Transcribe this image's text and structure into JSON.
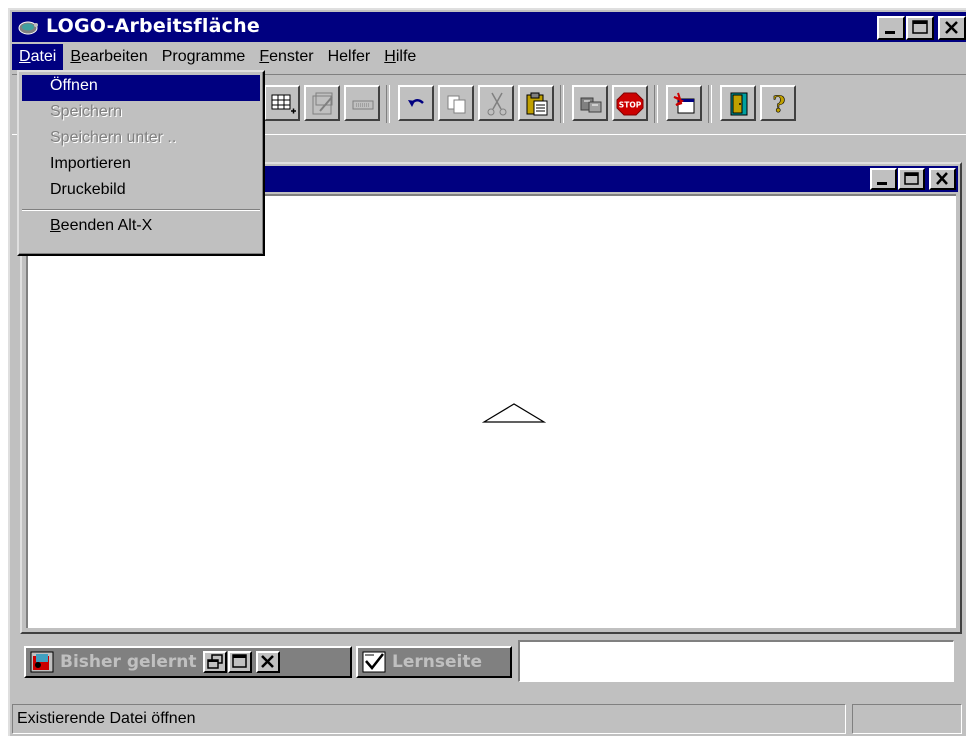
{
  "window": {
    "title": "LOGO-Arbeitsfläche"
  },
  "menubar": {
    "items": [
      {
        "label_u": "D",
        "label_rest": "atei"
      },
      {
        "label_u": "B",
        "label_rest": "earbeiten"
      },
      {
        "label_u": "",
        "label_rest": "Programme"
      },
      {
        "label_u": "F",
        "label_rest": "enster"
      },
      {
        "label_u": "",
        "label_rest": "Helfer"
      },
      {
        "label_u": "H",
        "label_rest": "ilfe"
      }
    ]
  },
  "file_menu": {
    "open": "Öffnen",
    "save": "Speichern",
    "save_as": "Speichern unter ..",
    "import": "Importieren",
    "print": "Druckebild",
    "exit_u": "B",
    "exit_rest": "eenden Alt-X"
  },
  "minimized": {
    "learned_title": "Bisher gelernt",
    "lesson_title": "Lernseite"
  },
  "statusbar": {
    "text": "Existierende Datei öffnen"
  },
  "colors": {
    "titlebar": "#000080",
    "face": "#c0c0c0",
    "stop_red": "#cc0000"
  },
  "icons": [
    "app-logo-icon",
    "minimize-icon",
    "maximize-icon",
    "close-icon",
    "restore-icon",
    "stop-icon",
    "help-icon",
    "exit-door-icon",
    "undo-icon",
    "copy-icon",
    "cut-icon",
    "paste-icon"
  ]
}
